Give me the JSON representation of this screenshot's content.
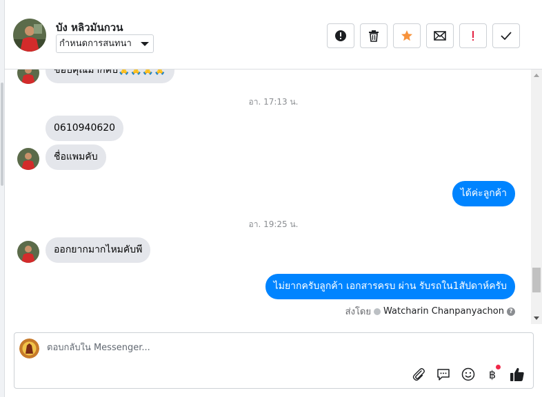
{
  "header": {
    "contact_name": "บัง หลิวมันกวน",
    "assign_label": "กำหนดการสนทนา",
    "tools": [
      {
        "icon": "exclamation-circle-icon"
      },
      {
        "icon": "trash-icon"
      },
      {
        "icon": "star-icon"
      },
      {
        "icon": "envelope-icon"
      },
      {
        "icon": "exclamation-icon"
      },
      {
        "icon": "checkmark-icon"
      }
    ]
  },
  "messages": {
    "partial_top": "ขอบคุณมากคับ🙏🙏🙏🙏",
    "timestamp_1": "อา. 17:13 น.",
    "phone": "0610940620",
    "name_msg": "ชื่อแพมคับ",
    "reply_1": "ได้ค่ะลูกค้า",
    "timestamp_2": "อา. 19:25 น.",
    "question": "ออกยากมากไหมคับพี",
    "reply_2": "ไม่ยากครับลูกค้า เอกสารครบ ผ่าน รับรถใน1สัปดาห์ครับ",
    "sent_by_label": "ส่งโดย",
    "sent_by_name": "Watcharin Chanpanyachon",
    "help_glyph": "?"
  },
  "composer": {
    "placeholder": "ตอบกลับใน Messenger...",
    "icons": [
      "paperclip-icon",
      "chat-bubble-icon",
      "smiley-icon",
      "baht-icon",
      "thumbs-up-icon"
    ],
    "baht_glyph": "฿"
  },
  "colors": {
    "outgoing_bubble": "#0084ff",
    "incoming_bubble": "#e4e6eb",
    "star": "#f7923b",
    "exclamation_red": "#e41e3f",
    "notification_dot": "#f02849"
  }
}
